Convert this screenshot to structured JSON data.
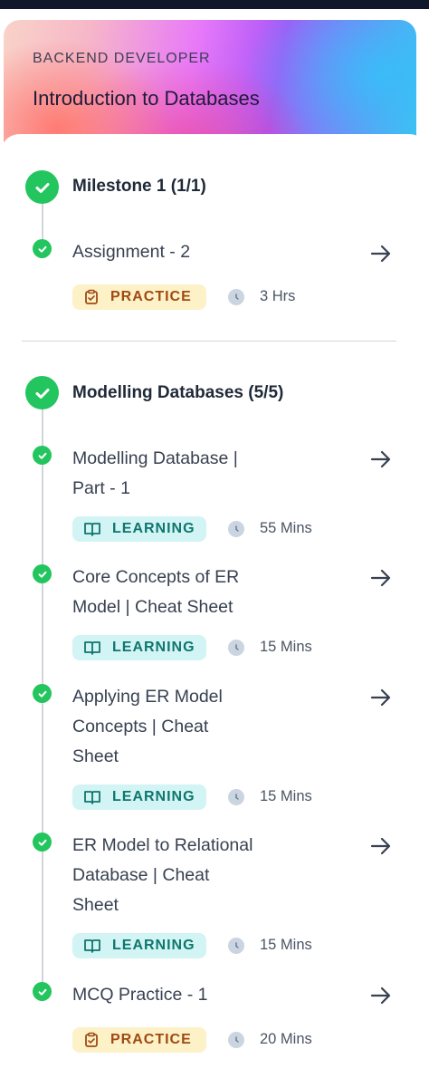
{
  "course": {
    "category": "BACKEND DEVELOPER",
    "title": "Introduction to Databases"
  },
  "milestones": [
    {
      "title": "Milestone 1 (1/1)",
      "items": [
        {
          "title": "Assignment - 2",
          "badge": "PRACTICE",
          "badge_icon": "clipboard-icon",
          "duration": "3 Hrs"
        }
      ]
    },
    {
      "title": "Modelling Databases (5/5)",
      "items": [
        {
          "title_lines": [
            "Modelling Database |",
            "Part - 1"
          ],
          "badge": "LEARNING",
          "badge_icon": "book-icon",
          "duration": "55 Mins"
        },
        {
          "title_lines": [
            "Core Concepts of ER",
            "Model | Cheat Sheet"
          ],
          "badge": "LEARNING",
          "badge_icon": "book-icon",
          "duration": "15 Mins"
        },
        {
          "title_lines": [
            "Applying ER Model",
            "Concepts | Cheat",
            "Sheet"
          ],
          "badge": "LEARNING",
          "badge_icon": "book-icon",
          "duration": "15 Mins"
        },
        {
          "title_lines": [
            "ER Model to Relational",
            "Database | Cheat",
            "Sheet"
          ],
          "badge": "LEARNING",
          "badge_icon": "book-icon",
          "duration": "15 Mins"
        },
        {
          "title_lines": [
            "MCQ Practice - 1"
          ],
          "badge": "PRACTICE",
          "badge_icon": "clipboard-icon",
          "duration": "20 Mins"
        }
      ]
    }
  ],
  "colors": {
    "completed": "#22c55e",
    "practice_bg": "#fdf1c7",
    "practice_text": "#a04a12",
    "learning_bg": "#d3f4f4",
    "learning_text": "#0f766e"
  }
}
